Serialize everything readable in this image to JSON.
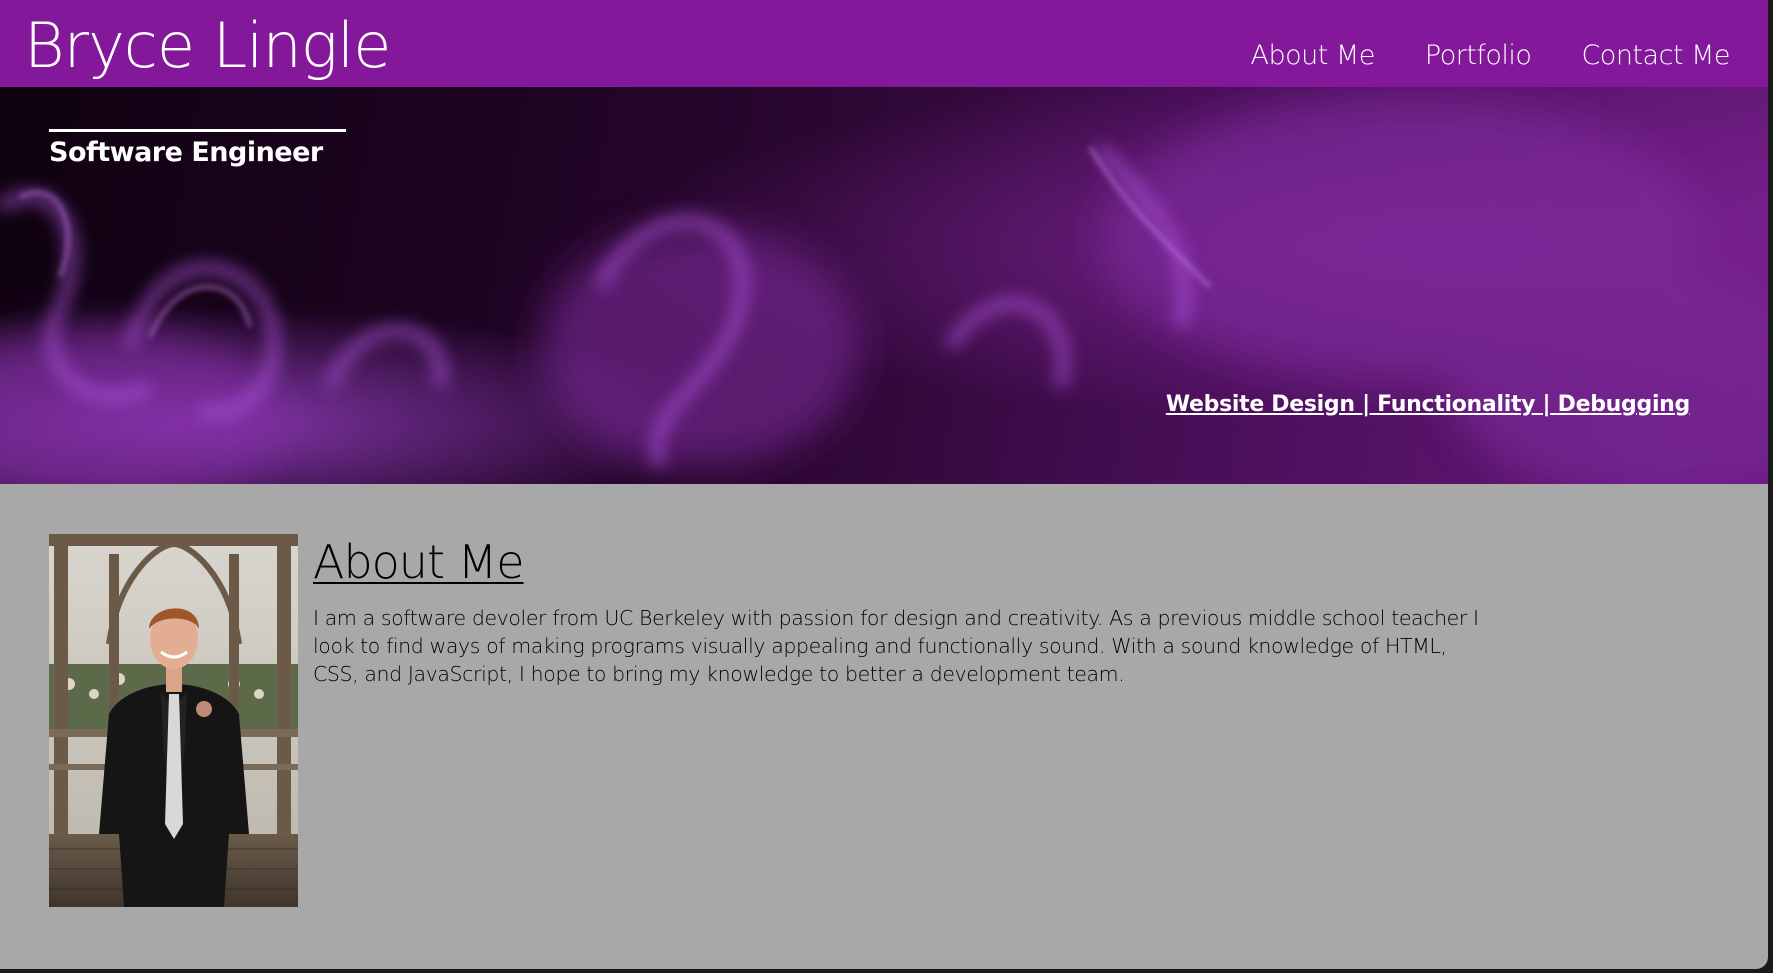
{
  "header": {
    "site_title": "Bryce Lingle",
    "nav": [
      {
        "label": "About Me"
      },
      {
        "label": "Portfolio"
      },
      {
        "label": "Contact Me"
      }
    ]
  },
  "hero": {
    "role": "Software Engineer",
    "skills_link": "Website Design | Functionality | Debugging"
  },
  "about": {
    "title": "About Me",
    "body": "I am a software devoler from UC Berkeley with passion for design and creativity. As a previous middle school teacher I look to find ways of making programs visually appealing and functionally sound. With a sound knowledge of HTML, CSS, and JavaScript, I hope to bring my knowledge to better a development team."
  },
  "colors": {
    "header_bg": "#83199a",
    "page_bg": "#a9a8a9",
    "hero_smoke": "#9b3fc7",
    "text_light": "#ffffff",
    "text_dark": "#000000"
  }
}
